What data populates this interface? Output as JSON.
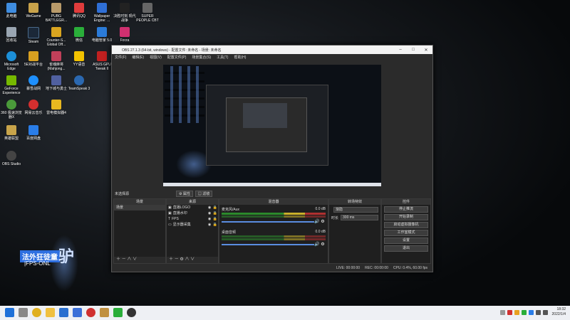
{
  "desktop": {
    "icons": [
      {
        "label": "此电脑",
        "color": "#3f8de0"
      },
      {
        "label": "WeGame",
        "color": "#c8a24a"
      },
      {
        "label": "PUBG BATTLEGR...",
        "color": "#b89a6a"
      },
      {
        "label": "腾讯QQ",
        "color": "#e03c3c"
      },
      {
        "label": "Wallpaper Engine: ...",
        "color": "#2f6fd6"
      },
      {
        "label": "决胜时刻 现代战争",
        "color": "#222222"
      },
      {
        "label": "SUPER PEOPLE CBT",
        "color": "#666666"
      },
      {
        "label": "回收站",
        "color": "#9aa6b2"
      },
      {
        "label": "Steam",
        "color": "#1b2838"
      },
      {
        "label": "Counter-S... Global Off...",
        "color": "#d9a520"
      },
      {
        "label": "微信",
        "color": "#2aae3a"
      },
      {
        "label": "电脑管家 5.0",
        "color": "#2b7bd8"
      },
      {
        "label": "Forza",
        "color": "#d03070"
      },
      {
        "label": "Microsoft Edge",
        "color": "#1c8fd8"
      },
      {
        "label": "5E对战平台",
        "color": "#d8a020"
      },
      {
        "label": "雀魂麻将 (Mahjong...",
        "color": "#c0405a"
      },
      {
        "label": "YY语音",
        "color": "#f2c200"
      },
      {
        "label": "ASUS GPU Tweak II",
        "color": "#c02020"
      },
      {
        "label": "GeForce Experience",
        "color": "#76b900"
      },
      {
        "label": "暴雪战网",
        "color": "#1e90ff"
      },
      {
        "label": "地下城与勇士",
        "color": "#5060a0"
      },
      {
        "label": "TeamSpeak 3",
        "color": "#2b68b0"
      },
      {
        "label": "360 极速浏览器X",
        "color": "#4a9a3a"
      },
      {
        "label": "网易云音乐",
        "color": "#d32f2f"
      },
      {
        "label": "雷电模拟器4",
        "color": "#e8b820"
      },
      {
        "label": "英雄联盟",
        "color": "#c8a44a"
      },
      {
        "label": "百度网盘",
        "color": "#2a7de8"
      },
      {
        "label": "OBS Studio",
        "color": "#444444"
      }
    ],
    "overlay": {
      "main": "法外狂徒童",
      "sub": "|FPS-ONL",
      "big": "驴"
    }
  },
  "obs": {
    "title": "OBS 27.1.3 (64-bit, windows) - 配置文件: 未命名 - 场景: 未命名",
    "menu": [
      "文件(F)",
      "编辑(E)",
      "视图(V)",
      "配置文件(P)",
      "场景集合(S)",
      "工具(T)",
      "帮助(H)"
    ],
    "mid": {
      "scene_label": "未选择源",
      "props": "属性",
      "filters": "滤镜"
    },
    "scenes": {
      "header": "场景",
      "items": [
        "场景"
      ]
    },
    "sources": {
      "header": "来源",
      "items": [
        "直播LOGO",
        "直播水印",
        "FPS",
        "显示器采集"
      ]
    },
    "mixer": {
      "header": "混音器",
      "tracks": [
        {
          "name": "麦克风/Aux",
          "db": "0.0 dB"
        },
        {
          "name": "桌面音频",
          "db": "0.0 dB"
        }
      ]
    },
    "transitions": {
      "header": "转场特效",
      "type": "渐隐",
      "dur_label": "时长",
      "dur": "300 ms"
    },
    "controls": {
      "header": "控件",
      "buttons": [
        "停止推流",
        "开始录制",
        "启动虚拟摄像机",
        "工作室模式",
        "设置",
        "退出"
      ]
    },
    "status": [
      "LIVE: 00:00:00",
      "REC: 00:00:00",
      "CPU: 0.4%, 60.00 fps"
    ]
  },
  "taskbar": {
    "icons": [
      {
        "name": "windows-start-icon",
        "color": "#1e70d8"
      },
      {
        "name": "search-icon",
        "color": "#888888"
      },
      {
        "name": "chrome-icon",
        "color": "#e0b020"
      },
      {
        "name": "explorer-icon",
        "color": "#f0c040"
      },
      {
        "name": "mail-icon",
        "color": "#2a6fd0"
      },
      {
        "name": "store-icon",
        "color": "#3b6fd8"
      },
      {
        "name": "netease-icon",
        "color": "#d03030"
      },
      {
        "name": "wegame-icon",
        "color": "#c09040"
      },
      {
        "name": "wechat-icon",
        "color": "#2aae3a"
      },
      {
        "name": "obs-icon",
        "color": "#333333"
      }
    ],
    "clock": {
      "time": "18:32",
      "date": "2022/1/4"
    }
  }
}
